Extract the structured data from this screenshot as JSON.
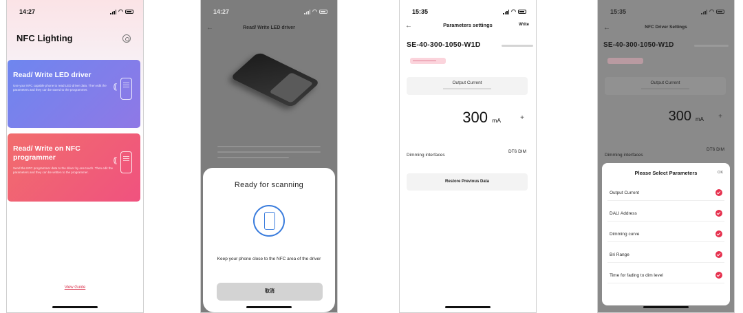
{
  "screen1": {
    "status_time": "14:27",
    "app_title": "NFC Lighting",
    "settings_icon": "gear-icon",
    "card1": {
      "title": "Read/ Write LED driver",
      "description": "Use your NFC capable phone to read LED driver data. Then edit the parameters and they can be saved to the programmer.",
      "color": "#7b80eb"
    },
    "card2": {
      "title": "Read/ Write on NFC programmer",
      "description": "Send the NFC programmer data to the driver by one touch. Then edit the parameters and they can be written to the programmer.",
      "color": "#f0607a"
    },
    "view_guide": "View Guide"
  },
  "screen2": {
    "status_time": "14:27",
    "nav_title": "Read/ Write LED driver",
    "sheet_title": "Ready for scanning",
    "sheet_message": "Keep your phone close to the NFC area of the driver",
    "cancel_label": "取消",
    "accent": "#3b7ddd"
  },
  "screen3": {
    "status_time": "15:35",
    "nav_title": "Parameters settings",
    "write_label": "Write",
    "model": "SE-40-300-1050-W1D",
    "output_label": "Output Current",
    "value": "300",
    "unit": "mA",
    "plus_label": "+",
    "dimming_label": "Dimming interfaces",
    "dimming_value": "DT6 DIM",
    "restore_label": "Restore Previous Data"
  },
  "screen4": {
    "status_time": "15:35",
    "nav_title": "NFC Driver Settings",
    "model": "SE-40-300-1050-W1D",
    "output_label": "Output Current",
    "value": "300",
    "unit": "mA",
    "plus_label": "+",
    "dimming_label": "Dimming interfaces",
    "dimming_value": "DT6 DIM",
    "sheet_title": "Please Select Parameters",
    "ok_label": "OK",
    "params": [
      {
        "label": "Output Current"
      },
      {
        "label": "DALI Address"
      },
      {
        "label": "Dimming curve"
      },
      {
        "label": "Bri Range"
      },
      {
        "label": "Time for fading to dim level"
      }
    ],
    "check_color": "#e6324f"
  }
}
